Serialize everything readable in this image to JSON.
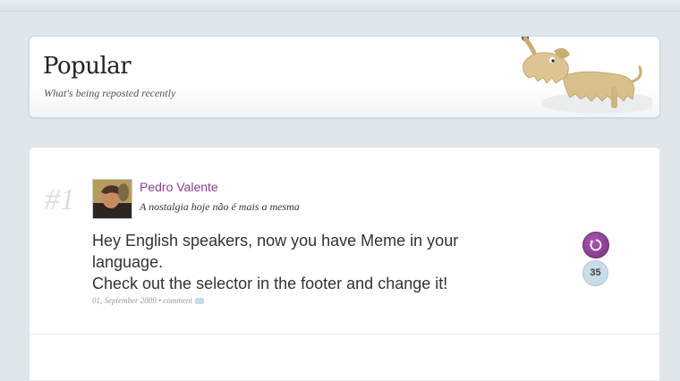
{
  "header": {
    "title": "Popular",
    "subtitle": "What's being reposted recently",
    "mascot": "dog-illustration"
  },
  "post": {
    "rank": "#1",
    "author": "Pedro Valente",
    "tagline": "A nostalgia hoje não é mais a mesma",
    "body_lines": [
      "Hey English speakers, now you have Meme in your",
      "language.",
      "Check out the selector in the footer and change it!"
    ],
    "date": "01, September 2009",
    "separator": " • ",
    "comment_label": "comment",
    "repost_count": "35",
    "icons": {
      "repost": "repost-icon",
      "comment": "comment-icon"
    }
  },
  "colors": {
    "background": "#dfe6ec",
    "author_link": "#8a3f8f",
    "repost_button": "#8a3f8f",
    "count_badge": "#c9dce7"
  }
}
